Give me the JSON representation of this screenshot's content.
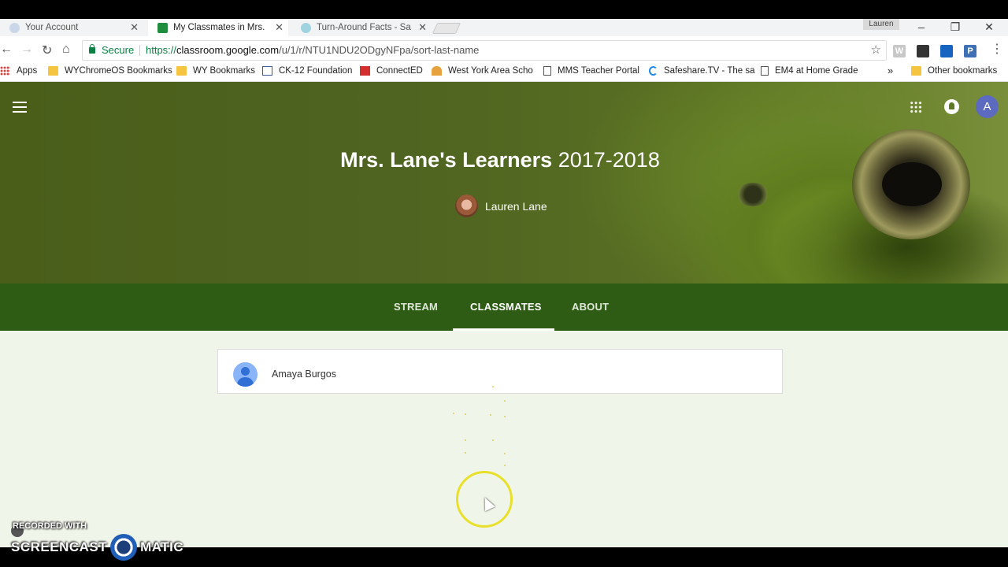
{
  "browser": {
    "tabs": [
      {
        "title": "Your Account",
        "active": false
      },
      {
        "title": "My Classmates in Mrs. La",
        "active": true
      },
      {
        "title": "Turn-Around Facts - Safe",
        "active": false
      }
    ],
    "profile_name": "Lauren",
    "omnibox": {
      "secure_label": "Secure",
      "url_scheme": "https://",
      "url_host": "classroom.google.com",
      "url_path": "/u/1/r/NTU1NDU2ODgyNFpa/sort-last-name"
    },
    "extensions": [
      "W",
      "",
      "",
      "P"
    ],
    "bookmarks": [
      {
        "label": "Apps",
        "icon": "apps-grid"
      },
      {
        "label": "WYChromeOS Bookmarks",
        "icon": "folder"
      },
      {
        "label": "WY Bookmarks",
        "icon": "folder"
      },
      {
        "label": "CK-12 Foundation",
        "icon": "ck12"
      },
      {
        "label": "ConnectED",
        "icon": "mcgraw-hill"
      },
      {
        "label": "West York Area Scho",
        "icon": "school"
      },
      {
        "label": "MMS Teacher Portal",
        "icon": "page"
      },
      {
        "label": "Safeshare.TV - The sa",
        "icon": "safeshare"
      },
      {
        "label": "EM4 at Home Grade",
        "icon": "page"
      }
    ],
    "bookmarks_overflow": "»",
    "other_bookmarks": "Other bookmarks"
  },
  "classroom": {
    "title_bold": "Mrs. Lane's Learners",
    "title_rest": "2017-2018",
    "teacher_name": "Lauren Lane",
    "account_initial": "A",
    "nav": {
      "stream": "STREAM",
      "classmates": "CLASSMATES",
      "about": "ABOUT",
      "active": "CLASSMATES"
    },
    "students": [
      {
        "name": "Amaya Burgos"
      }
    ]
  },
  "watermark": {
    "line1": "RECORDED WITH",
    "left": "SCREENCAST",
    "right": "MATIC"
  },
  "colors": {
    "class_nav_bg": "#2e5c15",
    "content_bg": "#f0f5e9",
    "secure_green": "#0b8043",
    "avatar_purple": "#5c6bc0"
  }
}
